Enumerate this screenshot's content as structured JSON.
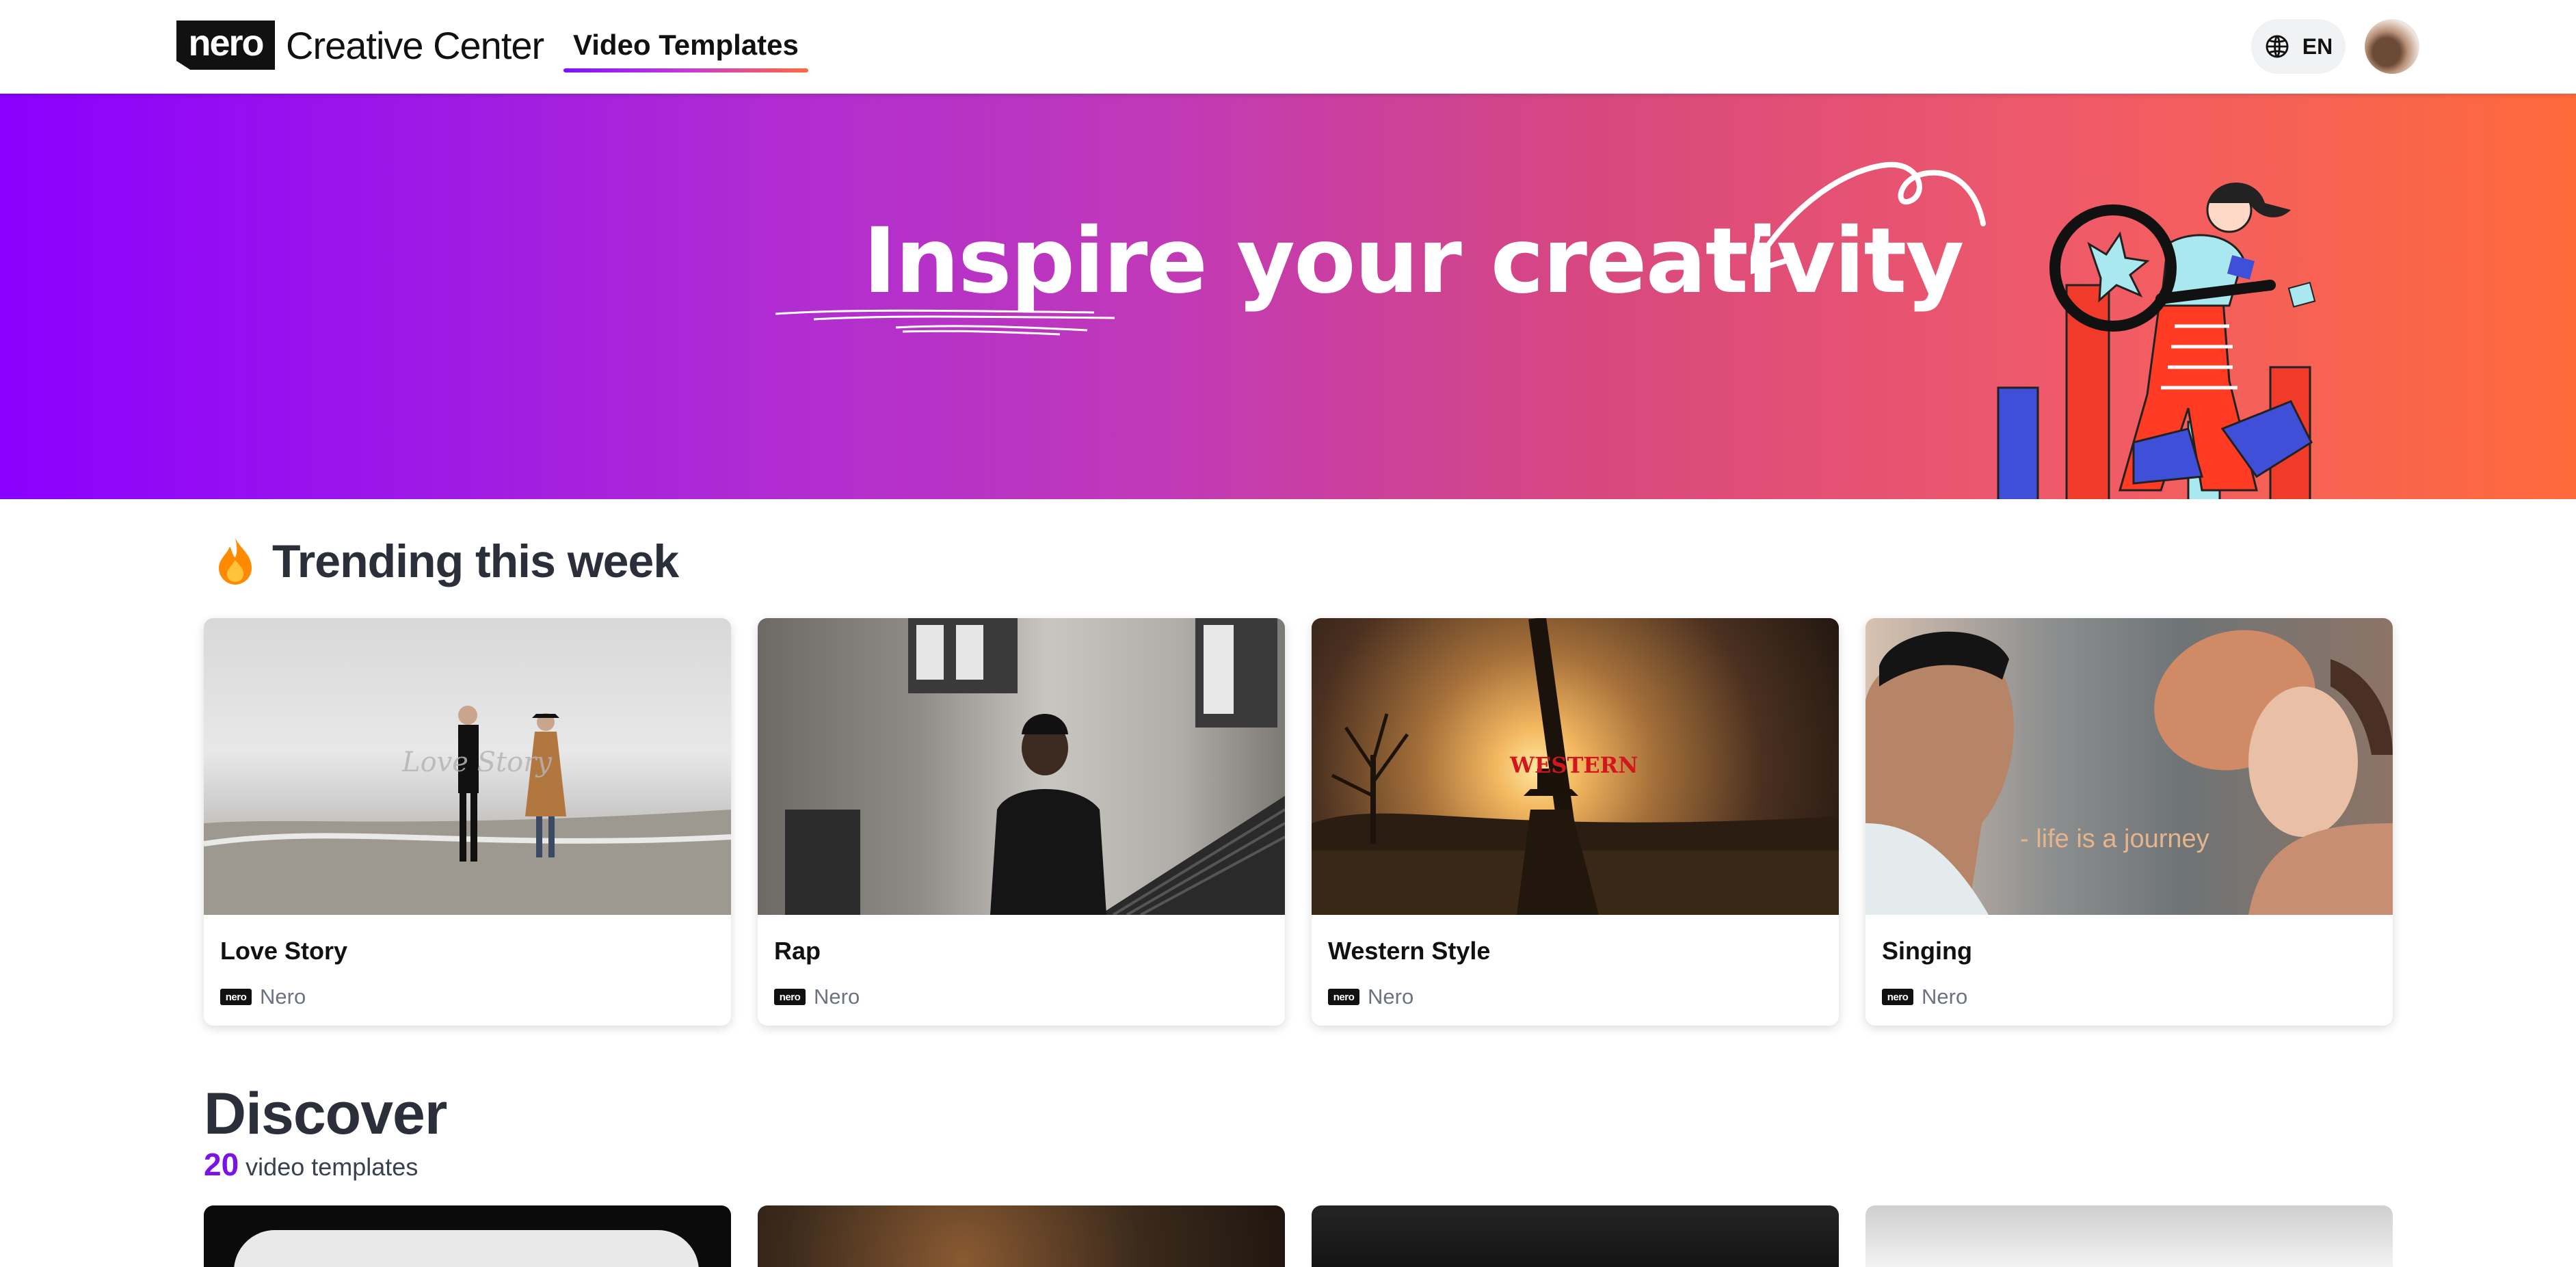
{
  "header": {
    "logo_text": "nero",
    "brand": "Creative Center",
    "nav_tab": "Video Templates",
    "language": "EN"
  },
  "hero": {
    "title": "Inspire your creativity"
  },
  "trending": {
    "title": "Trending this week",
    "cards": [
      {
        "title": "Love Story",
        "author": "Nero",
        "overlay": "Love Story"
      },
      {
        "title": "Rap",
        "author": "Nero",
        "overlay": ""
      },
      {
        "title": "Western Style",
        "author": "Nero",
        "overlay": "WESTERN"
      },
      {
        "title": "Singing",
        "author": "Nero",
        "overlay": "- life is a journey"
      }
    ]
  },
  "discover": {
    "title": "Discover",
    "count": "20",
    "count_label": "video templates"
  },
  "colors": {
    "accent_purple": "#7b12e6",
    "hero_start": "#8a00ff",
    "hero_end": "#ff6a3b"
  },
  "icons": {
    "language": "globe-icon",
    "trending": "fire-icon"
  }
}
